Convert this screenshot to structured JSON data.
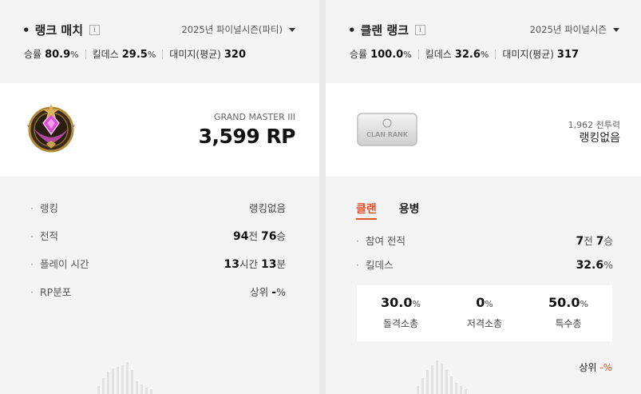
{
  "left": {
    "title": "랭크 매치",
    "info": "i",
    "season": "2025년 파이널시즌(파티)",
    "stats": [
      {
        "label": "승률",
        "value": "80.9",
        "unit": "%"
      },
      {
        "label": "킬데스",
        "value": "29.5",
        "unit": "%"
      },
      {
        "label": "대미지(평균)",
        "value": "320",
        "unit": ""
      }
    ],
    "tier": "GRAND MASTER III",
    "rp": "3,599 RP",
    "rows": {
      "ranking": {
        "label": "랭킹",
        "value": "랭킹없음"
      },
      "record": {
        "label": "전적",
        "n1": "94",
        "u1": "전",
        "n2": "76",
        "u2": "승"
      },
      "playtime": {
        "label": "플레이 시간",
        "n1": "13",
        "u1": "시간",
        "n2": "13",
        "u2": "분"
      },
      "rpdist": {
        "label": "RP분포",
        "prefix": "상위",
        "value": "-",
        "unit": "%"
      }
    }
  },
  "right": {
    "title": "클랜 랭크",
    "info": "i",
    "season": "2025년 파이널시즌",
    "stats": [
      {
        "label": "승률",
        "value": "100.0",
        "unit": "%"
      },
      {
        "label": "킬데스",
        "value": "32.6",
        "unit": "%"
      },
      {
        "label": "대미지(평균)",
        "value": "317",
        "unit": ""
      }
    ],
    "tag_text": "CLAN RANK",
    "power": "1,962 전투력",
    "norank": "랭킹없음",
    "tabs": [
      "클랜",
      "용병"
    ],
    "rows": {
      "participation": {
        "label": "참여 전적",
        "n1": "7",
        "u1": "전",
        "n2": "7",
        "u2": "승"
      },
      "kd": {
        "label": "킬데스",
        "n1": "32.6",
        "u1": "%"
      }
    },
    "weapons": [
      {
        "value": "30.0",
        "unit": "%",
        "label": "돌격소총"
      },
      {
        "value": "0",
        "unit": "%",
        "label": "저격소총"
      },
      {
        "value": "50.0",
        "unit": "%",
        "label": "특수총"
      }
    ],
    "rpdist": {
      "prefix": "상위",
      "value": "-%"
    }
  },
  "colors": {
    "accent": "#e0522d",
    "panel": "#f4f4f4",
    "card": "#ffffff"
  }
}
